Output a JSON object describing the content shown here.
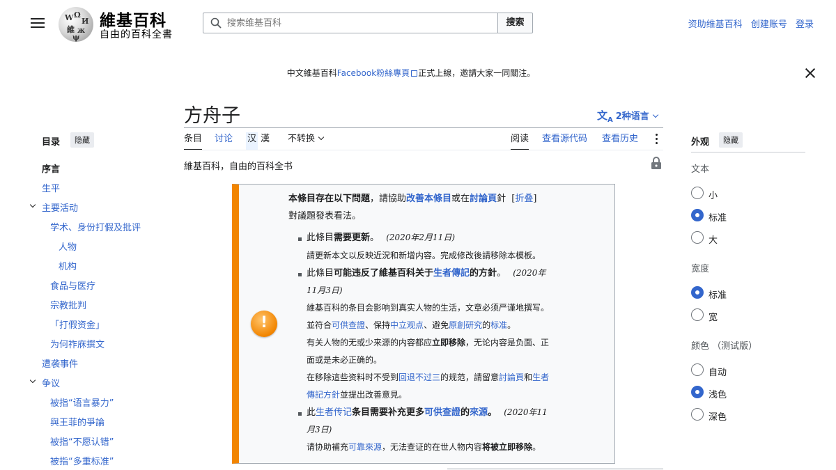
{
  "header": {
    "logo_title": "維基百科",
    "logo_tagline": "自由的百科全書",
    "search_placeholder": "搜索维基百科",
    "search_button": "搜索",
    "user_links": [
      "资助维基百科",
      "创建账号",
      "登录"
    ]
  },
  "banner": {
    "prefix": "中文維基百科",
    "link": "Facebook粉絲專頁",
    "suffix": "正式上線，邀請大家一同關注。"
  },
  "page": {
    "title": "方舟子",
    "languages_label": "2种语言",
    "site_sub": "維基百科，自由的百科全书"
  },
  "tabs": {
    "article": "条目",
    "talk": "讨论",
    "variant_simplified": "汉",
    "variant_traditional": "漢",
    "no_convert": "不转换",
    "read": "阅读",
    "view_source": "查看源代码",
    "history": "查看历史"
  },
  "toc": {
    "heading": "目录",
    "hide_label": "隐藏",
    "items": [
      {
        "label": "序言",
        "level": 0,
        "current": true
      },
      {
        "label": "生平",
        "level": 0
      },
      {
        "label": "主要活动",
        "level": 0,
        "expanded": true
      },
      {
        "label": "学术、身份打假及批评",
        "level": 1
      },
      {
        "label": "人物",
        "level": 2
      },
      {
        "label": "机构",
        "level": 2
      },
      {
        "label": "食品与医疗",
        "level": 1
      },
      {
        "label": "宗教批判",
        "level": 1
      },
      {
        "label": "「打假资金」",
        "level": 1
      },
      {
        "label": "为何祚庥撰文",
        "level": 1
      },
      {
        "label": "遭袭事件",
        "level": 0
      },
      {
        "label": "争议",
        "level": 0,
        "expanded": true
      },
      {
        "label": "被指“语言暴力”",
        "level": 1
      },
      {
        "label": "與王菲的爭論",
        "level": 1
      },
      {
        "label": "被指“不愿认错”",
        "level": 1
      },
      {
        "label": "被指“多重标准”",
        "level": 1
      }
    ]
  },
  "appearance": {
    "heading": "外观",
    "hide_label": "隐藏",
    "text_group": "文本",
    "text_options": [
      "小",
      "标准",
      "大"
    ],
    "text_selected": "标准",
    "width_group": "宽度",
    "width_options": [
      "标准",
      "宽"
    ],
    "width_selected": "标准",
    "color_group": "颜色 （测试版）",
    "color_options": [
      "自动",
      "浅色",
      "深色"
    ],
    "color_selected": "浅色"
  },
  "message_box": {
    "head_bold": "本條目存在以下問題",
    "head_mid": "，請協助",
    "head_link1": "改善本條目",
    "head_mid2": "或在",
    "head_link2": "討論頁",
    "head_end": "針",
    "collapse_label": "折叠",
    "head_line2": "對議題發表看法。",
    "issue1_pre": "此條目",
    "issue1_bold": "需要更新",
    "issue1_post": "。",
    "issue1_date": "(2020年2月11日)",
    "issue1_desc": "請更新本文以反映近況和新增内容。完成修改後請移除本模板。",
    "issue2_pre": "此條目",
    "issue2_bold": "可能违反了維基百科关于",
    "issue2_link": "生者傳記",
    "issue2_bold2": "的方針",
    "issue2_post": "。",
    "issue2_date_a": "(2020年",
    "issue2_date_b": "11月3日)",
    "issue2_desc1": "維基百科的条目会影响到真实人物的生活，文章必须严谨地撰写。",
    "issue2_desc2_pre": "並符合",
    "issue2_desc2_l1": "可供查證",
    "issue2_desc2_s1": "、保持",
    "issue2_desc2_l2": "中立观点",
    "issue2_desc2_s2": "、避免",
    "issue2_desc2_l3": "原創研究",
    "issue2_desc2_s3": "的",
    "issue2_desc2_l4": "标准",
    "issue2_desc2_end": "。",
    "issue2_desc3_pre": "有关人物的无或少来源的内容都应",
    "issue2_desc3_bold": "立即移除",
    "issue2_desc3_post": "，无论内容是负面、正",
    "issue2_desc4": "面或是未必正确的。",
    "issue2_desc5_pre": "在移除這些资料时不受到",
    "issue2_desc5_l1": "回退不过三",
    "issue2_desc5_mid": "的规范，請留意",
    "issue2_desc5_l2": "討論頁",
    "issue2_desc5_and": "和",
    "issue2_desc5_l3a": "生者",
    "issue2_desc6_l3b": "傳記方針",
    "issue2_desc6_post": "並提出改善意見。",
    "issue3_pre": "此",
    "issue3_link1": "生者传记",
    "issue3_bold": "条目需要补充更多",
    "issue3_link2": "可供查證",
    "issue3_bold2": "的",
    "issue3_link3": "來源",
    "issue3_post": "。",
    "issue3_date_a": "(2020年11",
    "issue3_date_b": "月3日)",
    "issue3_desc_pre": "请协助補充",
    "issue3_desc_link": "可靠來源",
    "issue3_desc_mid": "，无法查证的在世人物内容",
    "issue3_desc_bold": "将被立即移除",
    "issue3_desc_end": "。"
  }
}
